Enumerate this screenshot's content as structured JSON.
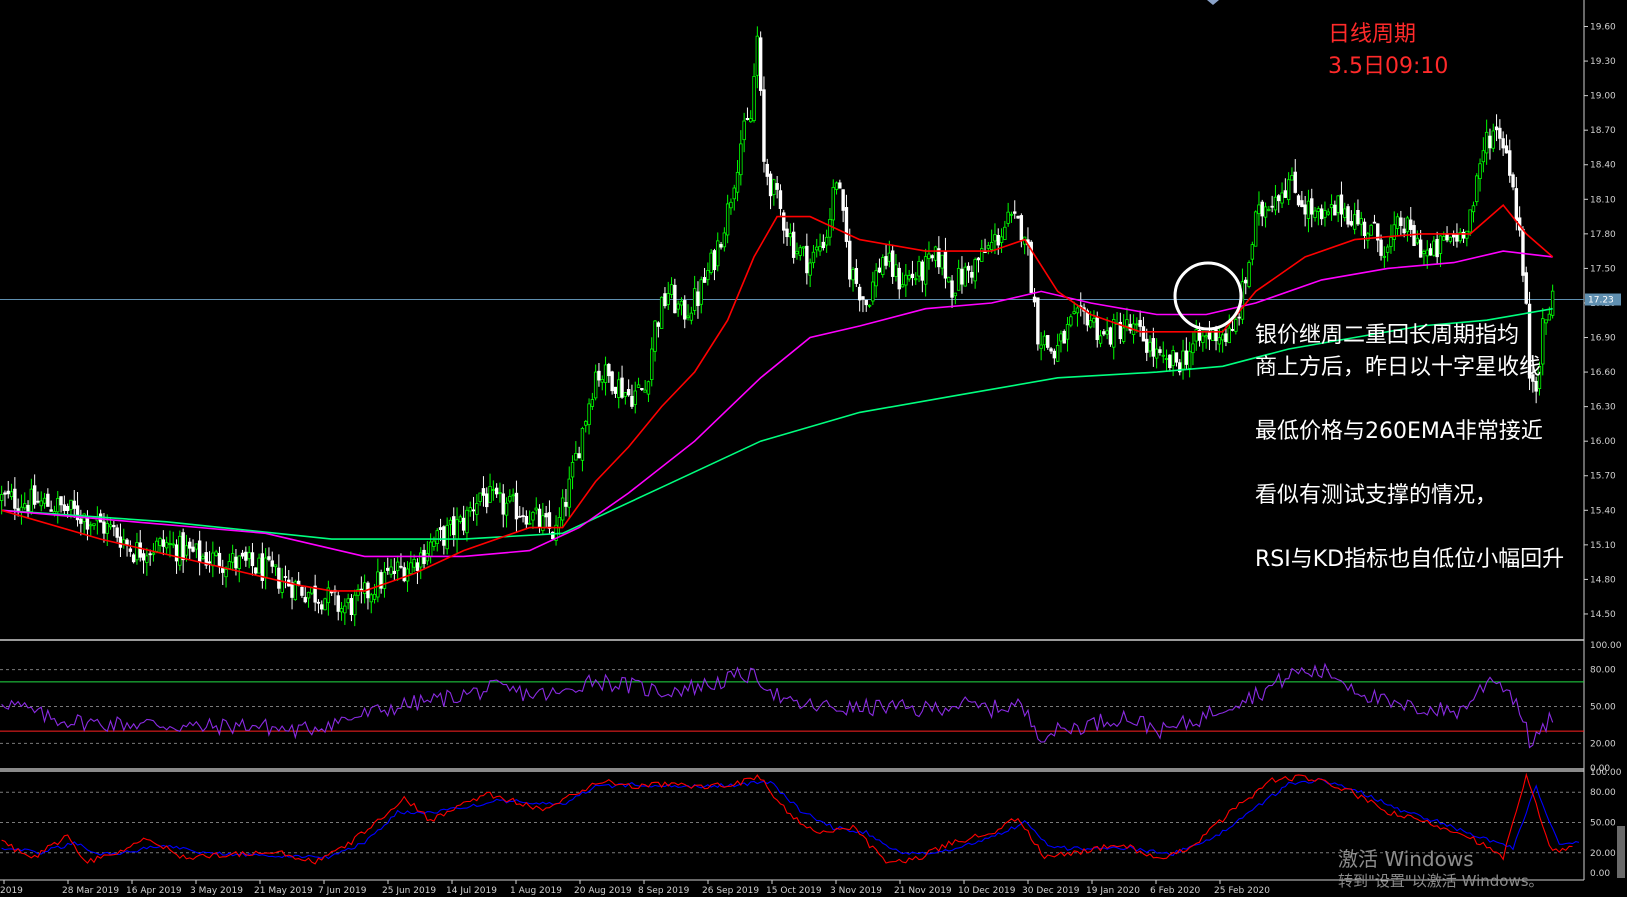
{
  "header": {
    "period_label": "日线周期",
    "time_label": "3.5日09:10"
  },
  "annotations": {
    "line1": "银价继周二重回长周期指均",
    "line2": "商上方后，昨日以十字星收线",
    "line3": "最低价格与260EMA非常接近",
    "line4": "看似有测试支撑的情况，",
    "line5": "RSI与KD指标也自低位小幅回升"
  },
  "watermark": {
    "title": "激活 Windows",
    "subtitle": "转到\"设置\"以激活 Windows。"
  },
  "colors": {
    "bull_candle": "#00ff00",
    "bear_candle": "#ffffff",
    "ema_fast": "#ff0000",
    "ema_mid": "#ff00ff",
    "ema_slow": "#00ff7f",
    "rsi_line": "#8a2be2",
    "kd_k": "#ff0000",
    "kd_d": "#0000ff",
    "annotation_circle": "#ffffff",
    "current_price_line": "#5f8fb0"
  },
  "chart_data": [
    {
      "type": "candlestick",
      "name": "price",
      "ylim": [
        14.3,
        19.7
      ],
      "yticks": [
        "19.60",
        "19.30",
        "19.00",
        "18.70",
        "18.40",
        "18.10",
        "17.80",
        "17.50",
        "17.20",
        "16.90",
        "16.60",
        "16.30",
        "16.00",
        "15.70",
        "15.40",
        "15.10",
        "14.80",
        "14.50"
      ],
      "current_price": "17.23",
      "xticks": [
        "2019",
        "28 Mar 2019",
        "16 Apr 2019",
        "3 May 2019",
        "21 May 2019",
        "7 Jun 2019",
        "25 Jun 2019",
        "14 Jul 2019",
        "1 Aug 2019",
        "20 Aug 2019",
        "8 Sep 2019",
        "26 Sep 2019",
        "15 Oct 2019",
        "3 Nov 2019",
        "21 Nov 2019",
        "10 Dec 2019",
        "30 Dec 2019",
        "19 Jan 2020",
        "6 Feb 2020",
        "25 Feb 2020"
      ],
      "close_path": [
        [
          0,
          15.5
        ],
        [
          15,
          15.45
        ],
        [
          25,
          15.35
        ],
        [
          35,
          15.2
        ],
        [
          40,
          15.05
        ],
        [
          50,
          15.1
        ],
        [
          60,
          15.0
        ],
        [
          70,
          14.95
        ],
        [
          78,
          14.9
        ],
        [
          85,
          14.8
        ],
        [
          92,
          14.7
        ],
        [
          98,
          14.65
        ],
        [
          103,
          14.55
        ],
        [
          108,
          14.6
        ],
        [
          113,
          14.75
        ],
        [
          118,
          14.85
        ],
        [
          125,
          14.95
        ],
        [
          130,
          15.1
        ],
        [
          135,
          15.2
        ],
        [
          140,
          15.3
        ],
        [
          145,
          15.55
        ],
        [
          150,
          15.45
        ],
        [
          158,
          15.4
        ],
        [
          165,
          15.25
        ],
        [
          168,
          15.2
        ],
        [
          172,
          15.6
        ],
        [
          176,
          16.1
        ],
        [
          180,
          16.6
        ],
        [
          185,
          16.55
        ],
        [
          190,
          16.4
        ],
        [
          195,
          16.45
        ],
        [
          198,
          17.0
        ],
        [
          202,
          17.3
        ],
        [
          206,
          17.1
        ],
        [
          211,
          17.25
        ],
        [
          216,
          17.6
        ],
        [
          220,
          18.0
        ],
        [
          224,
          18.6
        ],
        [
          227,
          18.8
        ],
        [
          229,
          19.5
        ],
        [
          231,
          18.4
        ],
        [
          236,
          18.0
        ],
        [
          240,
          17.7
        ],
        [
          245,
          17.55
        ],
        [
          250,
          17.8
        ],
        [
          253,
          18.3
        ],
        [
          257,
          17.5
        ],
        [
          262,
          17.2
        ],
        [
          267,
          17.6
        ],
        [
          272,
          17.4
        ],
        [
          278,
          17.45
        ],
        [
          284,
          17.6
        ],
        [
          288,
          17.35
        ],
        [
          294,
          17.5
        ],
        [
          300,
          17.7
        ],
        [
          305,
          17.9
        ],
        [
          310,
          17.85
        ],
        [
          314,
          16.95
        ],
        [
          319,
          16.75
        ],
        [
          324,
          17.0
        ],
        [
          329,
          17.1
        ],
        [
          334,
          16.9
        ],
        [
          340,
          17.0
        ],
        [
          346,
          16.9
        ],
        [
          352,
          16.65
        ],
        [
          357,
          16.7
        ],
        [
          362,
          16.85
        ],
        [
          368,
          16.95
        ],
        [
          373,
          16.9
        ],
        [
          377,
          17.4
        ],
        [
          380,
          17.9
        ],
        [
          384,
          18.1
        ],
        [
          390,
          18.25
        ],
        [
          395,
          18.05
        ],
        [
          400,
          17.9
        ],
        [
          406,
          18.05
        ],
        [
          411,
          17.9
        ],
        [
          416,
          17.8
        ],
        [
          420,
          17.65
        ],
        [
          424,
          17.9
        ],
        [
          428,
          17.75
        ],
        [
          433,
          17.6
        ],
        [
          438,
          17.75
        ],
        [
          442,
          17.8
        ],
        [
          446,
          18.05
        ],
        [
          450,
          18.65
        ],
        [
          454,
          18.7
        ],
        [
          457,
          18.4
        ],
        [
          460,
          17.8
        ],
        [
          462,
          17.1
        ],
        [
          463,
          16.6
        ],
        [
          465,
          16.55
        ],
        [
          467,
          16.95
        ],
        [
          470,
          17.25
        ]
      ],
      "ema_fast_path": [
        [
          0,
          15.4
        ],
        [
          30,
          15.15
        ],
        [
          60,
          14.95
        ],
        [
          90,
          14.75
        ],
        [
          100,
          14.7
        ],
        [
          110,
          14.7
        ],
        [
          125,
          14.85
        ],
        [
          140,
          15.05
        ],
        [
          160,
          15.25
        ],
        [
          170,
          15.25
        ],
        [
          180,
          15.65
        ],
        [
          190,
          15.95
        ],
        [
          200,
          16.3
        ],
        [
          210,
          16.6
        ],
        [
          220,
          17.05
        ],
        [
          228,
          17.6
        ],
        [
          235,
          17.95
        ],
        [
          245,
          17.95
        ],
        [
          260,
          17.75
        ],
        [
          280,
          17.65
        ],
        [
          300,
          17.65
        ],
        [
          310,
          17.75
        ],
        [
          320,
          17.3
        ],
        [
          330,
          17.1
        ],
        [
          345,
          16.95
        ],
        [
          360,
          16.95
        ],
        [
          370,
          16.95
        ],
        [
          380,
          17.3
        ],
        [
          395,
          17.6
        ],
        [
          410,
          17.75
        ],
        [
          430,
          17.8
        ],
        [
          445,
          17.8
        ],
        [
          455,
          18.05
        ],
        [
          462,
          17.8
        ],
        [
          470,
          17.6
        ]
      ],
      "ema_mid_path": [
        [
          0,
          15.4
        ],
        [
          40,
          15.3
        ],
        [
          80,
          15.2
        ],
        [
          110,
          15.0
        ],
        [
          140,
          15.0
        ],
        [
          160,
          15.05
        ],
        [
          175,
          15.25
        ],
        [
          190,
          15.55
        ],
        [
          210,
          16.0
        ],
        [
          230,
          16.55
        ],
        [
          245,
          16.9
        ],
        [
          260,
          17.0
        ],
        [
          280,
          17.15
        ],
        [
          300,
          17.2
        ],
        [
          315,
          17.3
        ],
        [
          330,
          17.2
        ],
        [
          350,
          17.1
        ],
        [
          365,
          17.1
        ],
        [
          380,
          17.2
        ],
        [
          400,
          17.4
        ],
        [
          420,
          17.5
        ],
        [
          440,
          17.55
        ],
        [
          455,
          17.65
        ],
        [
          470,
          17.6
        ]
      ],
      "ema_slow_path": [
        [
          0,
          15.4
        ],
        [
          50,
          15.3
        ],
        [
          100,
          15.15
        ],
        [
          140,
          15.15
        ],
        [
          170,
          15.2
        ],
        [
          200,
          15.6
        ],
        [
          230,
          16.0
        ],
        [
          260,
          16.25
        ],
        [
          290,
          16.4
        ],
        [
          320,
          16.55
        ],
        [
          350,
          16.6
        ],
        [
          370,
          16.65
        ],
        [
          390,
          16.8
        ],
        [
          410,
          16.9
        ],
        [
          430,
          17.0
        ],
        [
          450,
          17.05
        ],
        [
          470,
          17.15
        ]
      ]
    },
    {
      "type": "line",
      "name": "RSI",
      "ylim": [
        0,
        100
      ],
      "yticks": [
        "100.00",
        "80.00",
        "50.00",
        "20.00",
        "0.00"
      ],
      "levels": [
        70,
        30
      ],
      "path": [
        [
          0,
          55
        ],
        [
          15,
          40
        ],
        [
          30,
          36
        ],
        [
          45,
          36
        ],
        [
          60,
          33
        ],
        [
          75,
          35
        ],
        [
          90,
          30
        ],
        [
          105,
          40
        ],
        [
          120,
          50
        ],
        [
          135,
          57
        ],
        [
          150,
          65
        ],
        [
          160,
          60
        ],
        [
          170,
          60
        ],
        [
          178,
          72
        ],
        [
          190,
          67
        ],
        [
          200,
          62
        ],
        [
          215,
          68
        ],
        [
          225,
          76
        ],
        [
          230,
          72
        ],
        [
          238,
          52
        ],
        [
          248,
          50
        ],
        [
          258,
          48
        ],
        [
          268,
          50
        ],
        [
          278,
          47
        ],
        [
          290,
          52
        ],
        [
          300,
          48
        ],
        [
          308,
          52
        ],
        [
          315,
          27
        ],
        [
          325,
          33
        ],
        [
          340,
          42
        ],
        [
          352,
          30
        ],
        [
          362,
          39
        ],
        [
          372,
          52
        ],
        [
          382,
          62
        ],
        [
          392,
          78
        ],
        [
          402,
          78
        ],
        [
          412,
          62
        ],
        [
          422,
          50
        ],
        [
          432,
          48
        ],
        [
          442,
          46
        ],
        [
          452,
          75
        ],
        [
          459,
          55
        ],
        [
          463,
          22
        ],
        [
          467,
          30
        ],
        [
          470,
          42
        ]
      ]
    },
    {
      "type": "line",
      "name": "KD",
      "ylim": [
        0,
        100
      ],
      "yticks": [
        "100.00",
        "80.00",
        "50.00",
        "20.00",
        "0.00"
      ],
      "k_path": [
        [
          0,
          30
        ],
        [
          10,
          15
        ],
        [
          20,
          38
        ],
        [
          25,
          10
        ],
        [
          35,
          20
        ],
        [
          45,
          35
        ],
        [
          55,
          15
        ],
        [
          70,
          18
        ],
        [
          85,
          20
        ],
        [
          95,
          10
        ],
        [
          105,
          28
        ],
        [
          115,
          55
        ],
        [
          122,
          75
        ],
        [
          130,
          52
        ],
        [
          140,
          70
        ],
        [
          148,
          78
        ],
        [
          158,
          68
        ],
        [
          165,
          62
        ],
        [
          172,
          75
        ],
        [
          182,
          92
        ],
        [
          192,
          85
        ],
        [
          202,
          88
        ],
        [
          212,
          85
        ],
        [
          222,
          88
        ],
        [
          230,
          95
        ],
        [
          238,
          60
        ],
        [
          248,
          38
        ],
        [
          258,
          45
        ],
        [
          268,
          10
        ],
        [
          278,
          15
        ],
        [
          288,
          30
        ],
        [
          300,
          40
        ],
        [
          308,
          55
        ],
        [
          316,
          15
        ],
        [
          328,
          22
        ],
        [
          340,
          28
        ],
        [
          352,
          12
        ],
        [
          362,
          30
        ],
        [
          374,
          65
        ],
        [
          385,
          92
        ],
        [
          395,
          95
        ],
        [
          408,
          82
        ],
        [
          420,
          60
        ],
        [
          432,
          50
        ],
        [
          444,
          38
        ],
        [
          455,
          15
        ],
        [
          462,
          95
        ],
        [
          470,
          20
        ],
        [
          476,
          28
        ]
      ],
      "d_path": [
        [
          0,
          25
        ],
        [
          12,
          20
        ],
        [
          22,
          30
        ],
        [
          30,
          18
        ],
        [
          40,
          22
        ],
        [
          50,
          28
        ],
        [
          60,
          20
        ],
        [
          75,
          18
        ],
        [
          90,
          17
        ],
        [
          100,
          16
        ],
        [
          110,
          30
        ],
        [
          120,
          60
        ],
        [
          130,
          60
        ],
        [
          140,
          65
        ],
        [
          150,
          72
        ],
        [
          160,
          70
        ],
        [
          170,
          68
        ],
        [
          180,
          85
        ],
        [
          192,
          88
        ],
        [
          205,
          86
        ],
        [
          215,
          86
        ],
        [
          225,
          88
        ],
        [
          233,
          90
        ],
        [
          242,
          62
        ],
        [
          252,
          45
        ],
        [
          262,
          40
        ],
        [
          272,
          20
        ],
        [
          282,
          18
        ],
        [
          292,
          28
        ],
        [
          302,
          38
        ],
        [
          310,
          50
        ],
        [
          318,
          25
        ],
        [
          330,
          24
        ],
        [
          342,
          25
        ],
        [
          354,
          18
        ],
        [
          366,
          32
        ],
        [
          378,
          60
        ],
        [
          390,
          88
        ],
        [
          400,
          92
        ],
        [
          412,
          80
        ],
        [
          424,
          62
        ],
        [
          436,
          50
        ],
        [
          448,
          35
        ],
        [
          458,
          25
        ],
        [
          465,
          85
        ],
        [
          472,
          28
        ],
        [
          478,
          30
        ]
      ]
    }
  ]
}
